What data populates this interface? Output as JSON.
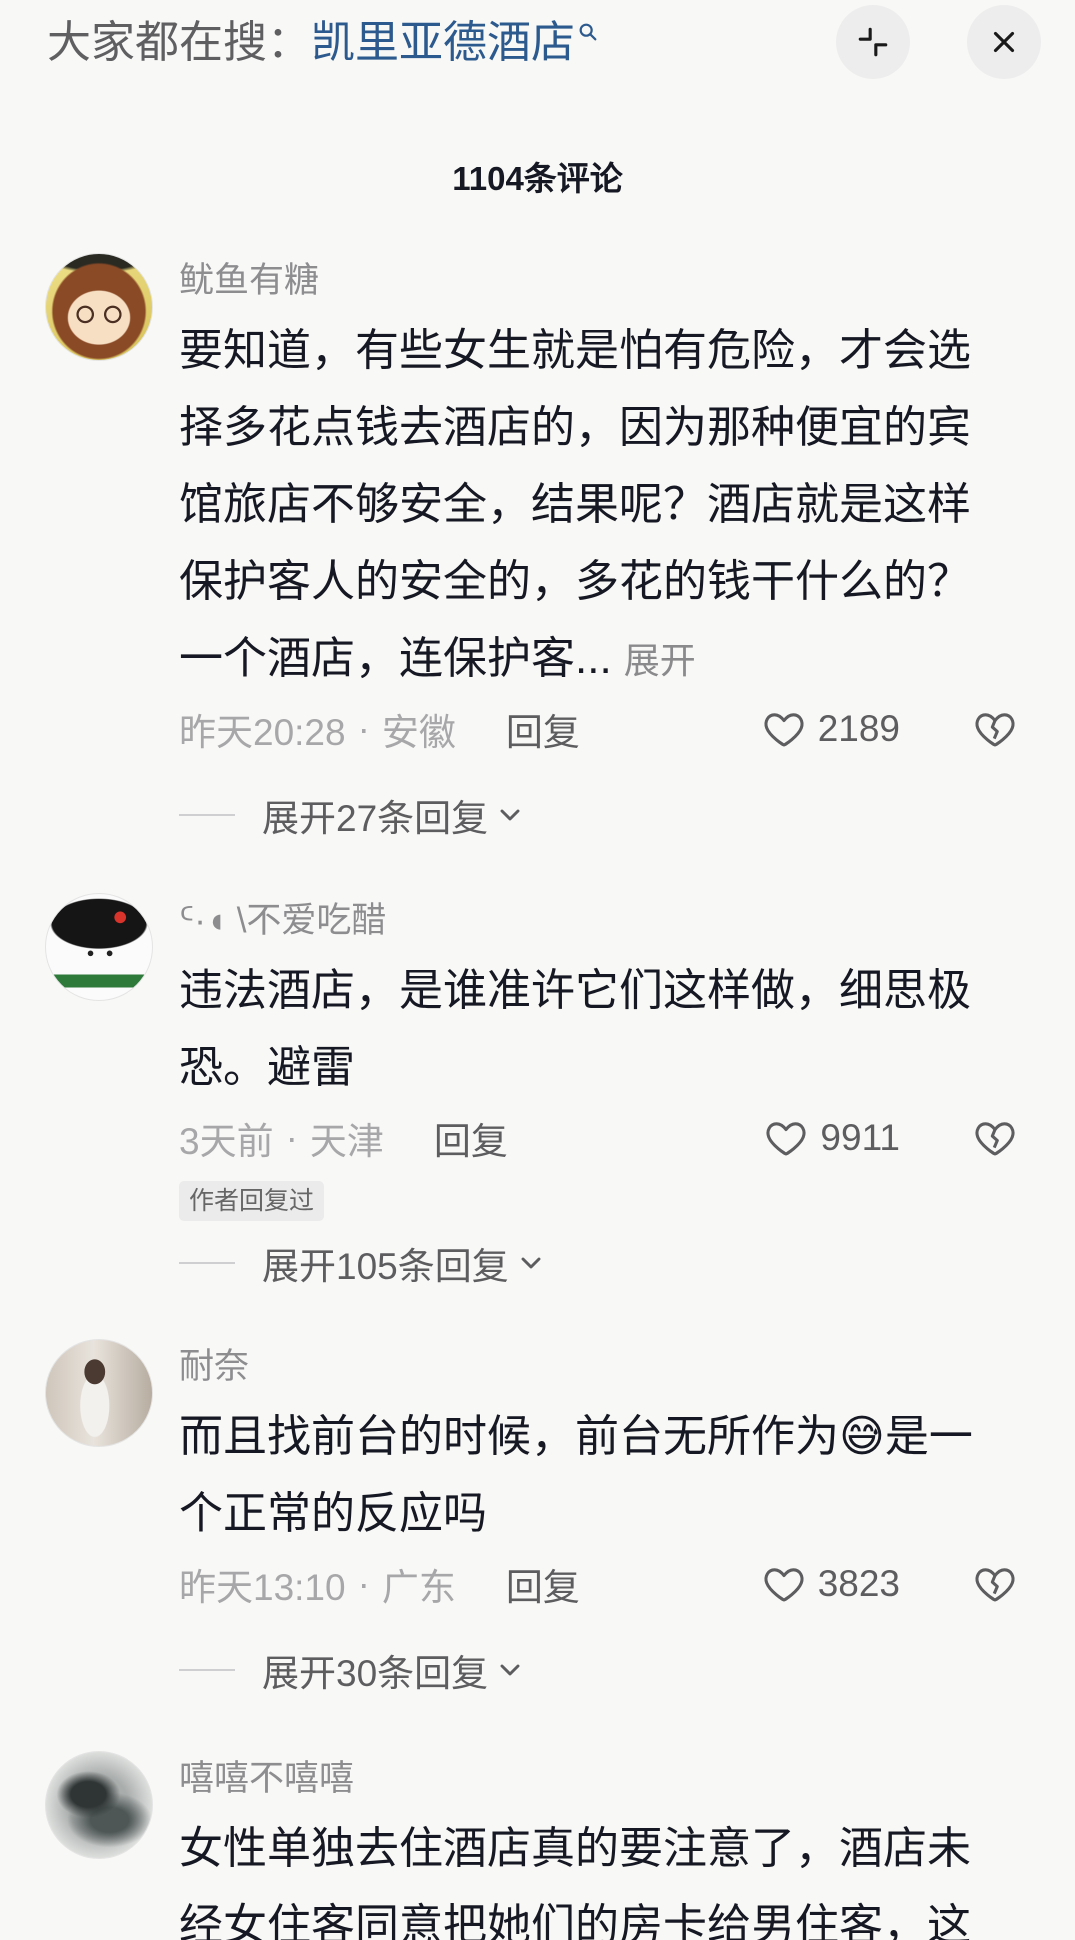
{
  "colors": {
    "background": "#f8f8f6",
    "text_primary": "#161823",
    "text_secondary": "#a7a7a9",
    "text_username": "#8d8d90",
    "text_action": "#5d5d60",
    "link": "#2d5a8e"
  },
  "search_bar": {
    "prefix": "大家都在搜：",
    "query": "凯里亚德酒店",
    "icons": {
      "search": "search-icon",
      "collapse": "collapse-icon",
      "close": "close-icon"
    }
  },
  "comment_count_title": "1104条评论",
  "icons": {
    "like": "heart-outline-icon",
    "dislike": "broken-heart-icon",
    "expand": "chevron-down-icon"
  },
  "comments": [
    {
      "username": "鱿鱼有糖",
      "text_lines": [
        "要知道，有些女生就是怕有危险，才会选",
        "择多花点钱去酒店的，因为那种便宜的宾",
        "馆旅店不够安全，结果呢？酒店就是这样",
        "保护客人的安全的，多花的钱干什么的？",
        "一个酒店，连保护客..."
      ],
      "expand_label": "展开",
      "time": "昨天20:28",
      "separator": "·",
      "location": "安徽",
      "reply_label": "回复",
      "likes": "2189",
      "replies_expand": "展开27条回复"
    },
    {
      "username": "ᑦ·◖ \\不爱吃醋",
      "text_lines": [
        "违法酒店，是谁准许它们这样做，细思极",
        "恐。避雷"
      ],
      "time": "3天前",
      "separator": "·",
      "location": "天津",
      "reply_label": "回复",
      "likes": "9911",
      "author_badge": "作者回复过",
      "replies_expand": "展开105条回复"
    },
    {
      "username": "耐奈",
      "text_lines": [
        "而且找前台的时候，前台无所作为😅是一",
        "个正常的反应吗"
      ],
      "time": "昨天13:10",
      "separator": "·",
      "location": "广东",
      "reply_label": "回复",
      "likes": "3823",
      "replies_expand": "展开30条回复"
    },
    {
      "username": "嘻嘻不嘻嘻",
      "text_lines": [
        "女性单独去住酒店真的要注意了，酒店未",
        "经女住客同意把她们的房卡给男住客，这"
      ]
    }
  ]
}
